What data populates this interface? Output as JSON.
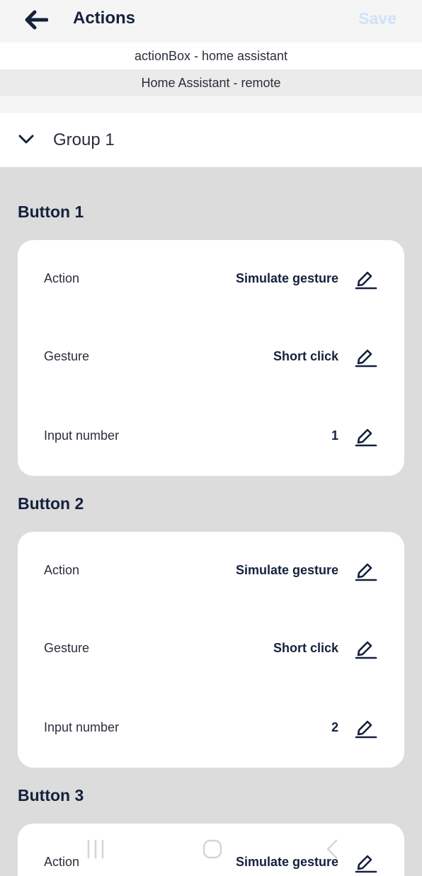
{
  "appbar": {
    "title": "Actions",
    "save_label": "Save",
    "back_icon": "arrow-left-icon"
  },
  "device": {
    "name": "actionBox - home assistant",
    "profile": "Home Assistant - remote"
  },
  "group": {
    "label": "Group 1",
    "expanded": true
  },
  "buttons": [
    {
      "title": "Button 1",
      "rows": [
        {
          "label": "Action",
          "value": "Simulate gesture"
        },
        {
          "label": "Gesture",
          "value": "Short click"
        },
        {
          "label": "Input number",
          "value": "1"
        }
      ]
    },
    {
      "title": "Button 2",
      "rows": [
        {
          "label": "Action",
          "value": "Simulate gesture"
        },
        {
          "label": "Gesture",
          "value": "Short click"
        },
        {
          "label": "Input number",
          "value": "2"
        }
      ]
    },
    {
      "title": "Button 3",
      "rows": [
        {
          "label": "Action",
          "value": "Simulate gesture"
        }
      ]
    }
  ],
  "colors": {
    "primary": "#14213d",
    "save_disabled": "#cfe2f8",
    "background": "#dcdcdc",
    "card": "#ffffff"
  }
}
